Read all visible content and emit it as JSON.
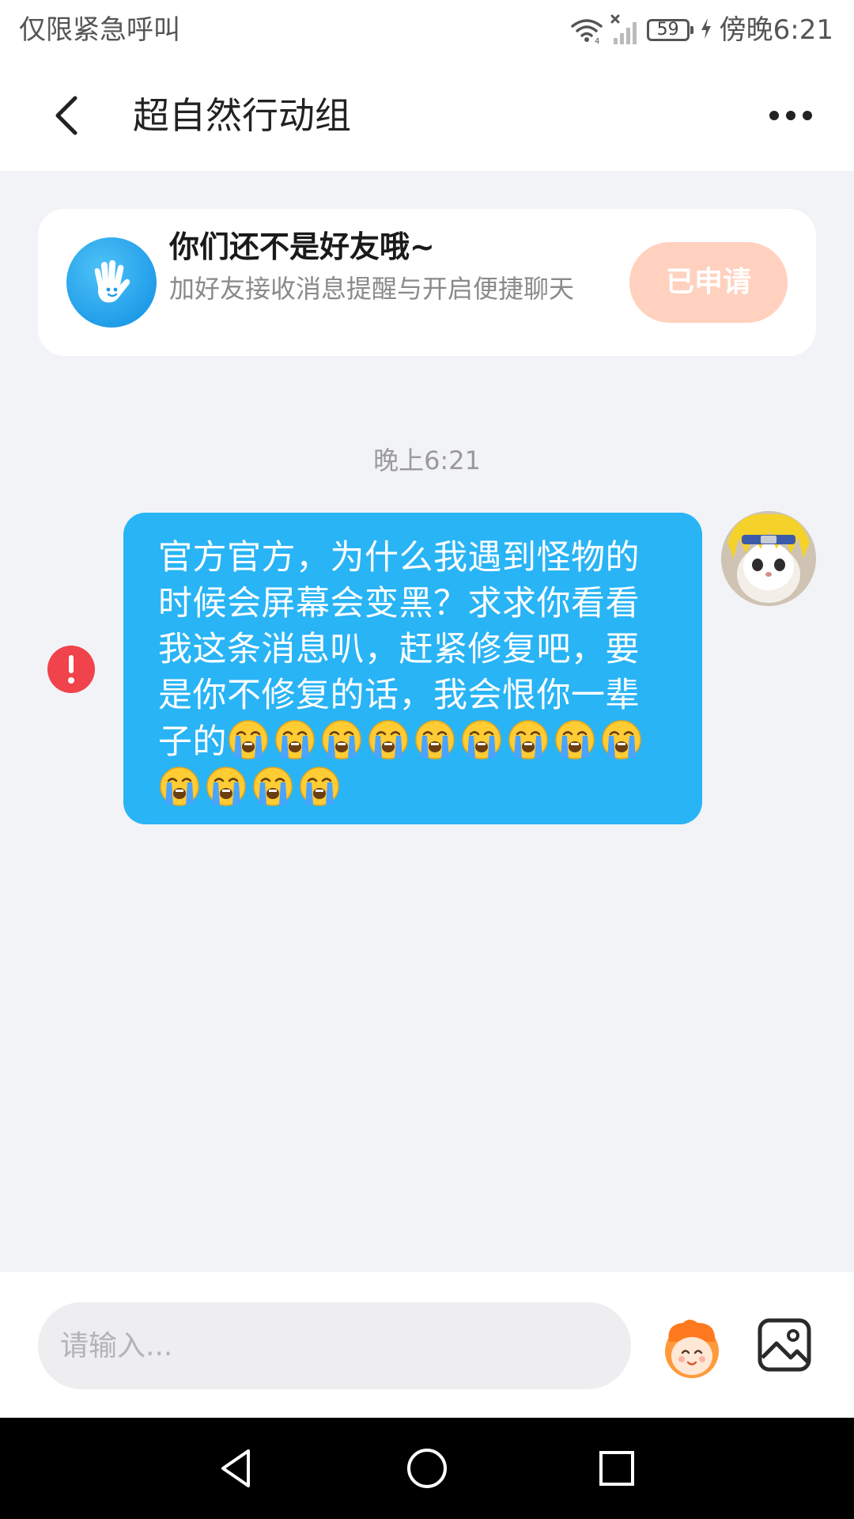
{
  "status_bar": {
    "carrier": "仅限紧急呼叫",
    "battery": "59",
    "time": "傍晚6:21"
  },
  "nav": {
    "title": "超自然行动组",
    "back_icon": "chevron-left-icon",
    "more_icon": "more-horizontal-icon"
  },
  "friend_card": {
    "title": "你们还不是好友哦~",
    "description": "加好友接收消息提醒与开启便捷聊天",
    "button_label": "已申请",
    "button_color": "#ffd1be",
    "avatar_color": "#1e9be8"
  },
  "chat": {
    "timestamp": "晚上6:21",
    "messages": [
      {
        "sender": "self",
        "text": "官方官方，为什么我遇到怪物的时候会屏幕会变黑？求求你看看我这条消息叭，赶紧修复吧，要是你不修复的话，我会恨你一辈子的",
        "emoji_count": 13,
        "emoji": "loudly-crying-face",
        "status": "failed",
        "bubble_color": "#29b4f5"
      }
    ]
  },
  "input_bar": {
    "placeholder": "请输入...",
    "sticker_icon": "sticker-icon",
    "image_icon": "image-icon"
  },
  "system_nav": {
    "back_icon": "triangle-back-icon",
    "home_icon": "circle-home-icon",
    "recents_icon": "square-recents-icon"
  },
  "colors": {
    "background": "#f2f3f7",
    "error": "#f0434b"
  }
}
